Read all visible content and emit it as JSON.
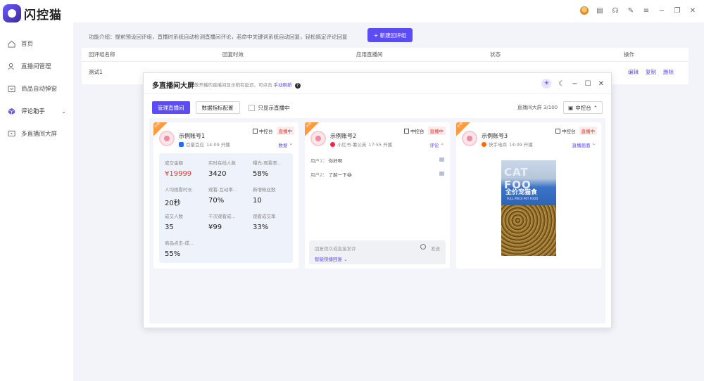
{
  "app": {
    "name": "闪控猫"
  },
  "sidebar": {
    "items": [
      {
        "label": "首页",
        "icon": "home-icon"
      },
      {
        "label": "直播间管理",
        "icon": "user-icon"
      },
      {
        "label": "商品自动弹窗",
        "icon": "window-icon"
      },
      {
        "label": "评论助手",
        "icon": "cube-icon",
        "active": true
      },
      {
        "label": "多直播间大屏",
        "icon": "screen-icon"
      }
    ]
  },
  "page": {
    "intro": "功能介绍：提前预设回评组，直播时系统自动检测直播间评论，若命中关键词系统自动回复，轻松搞定评论回复",
    "new_button": "+ 新建回评组",
    "table": {
      "headers": [
        "回评组名称",
        "回复时效",
        "应用直播间",
        "状态",
        "操作"
      ],
      "rows": [
        {
          "name": "测试1",
          "ops": [
            "编辑",
            "复制",
            "删除"
          ]
        }
      ]
    }
  },
  "modal": {
    "title": "多直播间大屏",
    "subtitle": "敬开播的直播间显示稍有延迟，可点击",
    "refresh_link": "手动刷新",
    "manage_button": "管理直播间",
    "metrics_button": "数据指标配置",
    "only_live_label": "只显示直播中",
    "screen_count": "直播间大屏 3/100",
    "center_ctrl": "中控台",
    "cards": [
      {
        "name": "示例账号1",
        "platform": "巨量百应",
        "time": "14:09 开播",
        "ctrl": "中控台",
        "live": "直播中",
        "expand": "数据",
        "ribbon": "示例",
        "stats": [
          {
            "label": "成交金额",
            "value": "¥19999",
            "red": true
          },
          {
            "label": "实时在线人数",
            "value": "3420"
          },
          {
            "label": "曝光-观看率...",
            "value": "58%"
          },
          {
            "label": "人均观看时长",
            "value": "20秒"
          },
          {
            "label": "观看-互动率...",
            "value": "70%"
          },
          {
            "label": "新增粉丝数",
            "value": "10"
          },
          {
            "label": "成交人数",
            "value": "35"
          },
          {
            "label": "千次观看成...",
            "value": "¥99"
          },
          {
            "label": "观看成交率",
            "value": "33%"
          },
          {
            "label": "商品点击-成...",
            "value": "55%"
          }
        ]
      },
      {
        "name": "示例账号2",
        "platform": "小红书-薯公英",
        "time": "17:55 开播",
        "ctrl": "中控台",
        "live": "直播中",
        "expand": "评论",
        "ribbon": "示例",
        "messages": [
          {
            "user": "用户1：",
            "text": "你好啊"
          },
          {
            "user": "用户2：",
            "text": "了解一下😂"
          }
        ],
        "reply_placeholder": "回复观众或直接发评",
        "send": "发送",
        "quick": "智能快捷回复"
      },
      {
        "name": "示例账号3",
        "platform": "快手电商",
        "time": "14:09 开播",
        "ctrl": "中控台",
        "live": "直播中",
        "expand": "直播画面",
        "ribbon": "示例",
        "preview": {
          "cat_text": "CAT FOO",
          "cn_text": "全价宠猫食",
          "en_text": "FULL PRICE PET FOOD"
        }
      }
    ]
  },
  "colors": {
    "accent": "#5b4cf5",
    "live": "#e53935",
    "bg": "#f2f4fa"
  }
}
